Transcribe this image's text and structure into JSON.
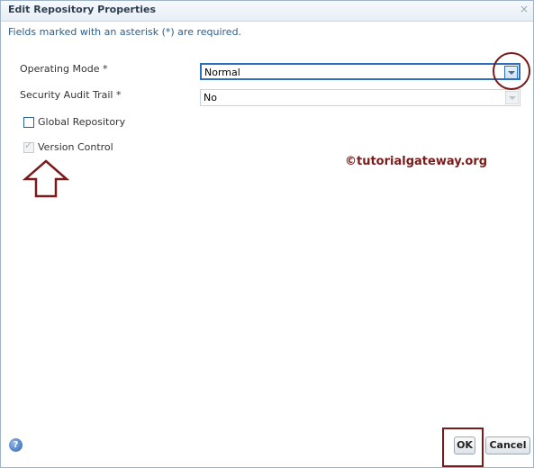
{
  "dialog": {
    "title": "Edit Repository Properties",
    "close_glyph": "×",
    "required_note": "Fields marked with an asterisk (*) are required."
  },
  "fields": {
    "operating_mode": {
      "label": "Operating Mode *",
      "value": "Normal"
    },
    "security_audit_trail": {
      "label": "Security Audit Trail *",
      "value": "No"
    }
  },
  "checkboxes": {
    "global_repository": {
      "label": "Global Repository",
      "checked": false
    },
    "version_control": {
      "label": "Version Control",
      "checked": true,
      "disabled": true,
      "tick_glyph": "✓"
    }
  },
  "watermark": "©tutorialgateway.org",
  "footer": {
    "help_glyph": "?",
    "ok_label": "OK",
    "cancel_label": "Cancel"
  },
  "colors": {
    "annotation": "#7a1a1a",
    "focus": "#2f6fc0",
    "note_text": "#2b5d8b"
  }
}
